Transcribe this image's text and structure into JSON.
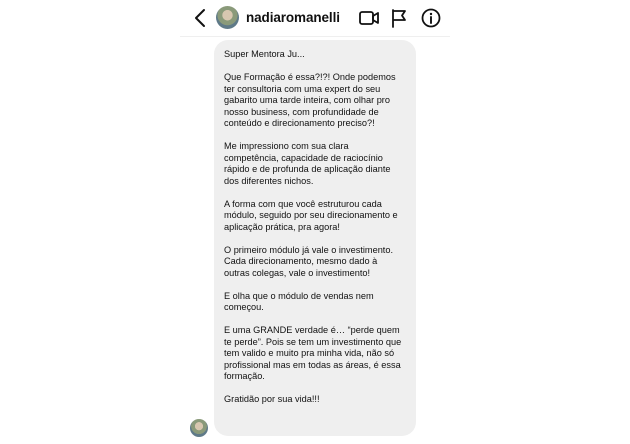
{
  "header": {
    "username": "nadiaromanelli",
    "icons": [
      "back-arrow-icon",
      "video-camera-icon",
      "flag-icon",
      "info-icon"
    ]
  },
  "message": {
    "paragraphs": [
      "Super Mentora Ju...",
      "Que Formação é essa?!?! Onde podemos\nter consultoria com uma expert do seu\ngabarito uma tarde inteira, com olhar pro\nnosso business, com  profundidade de\nconteúdo e direcionamento preciso?!",
      "Me impressiono com sua clara\ncompetência, capacidade de raciocínio\nrápido e de profunda de aplicação diante\ndos diferentes nichos.",
      "A forma com que você estruturou cada\nmódulo, seguido por seu direcionamento e\naplicação prática, pra agora!",
      "O primeiro módulo já vale o investimento.\nCada direcionamento, mesmo dado à\noutras colegas, vale o investimento!",
      "E olha que o módulo de vendas nem\ncomeçou.",
      "E uma GRANDE verdade é… “perde quem\nte perde”. Pois se tem um investimento que\ntem valido e muito pra minha vida, não só\nprofissional mas em todas as áreas, é essa\nformação.",
      "Gratidão por sua vida!!!"
    ]
  }
}
